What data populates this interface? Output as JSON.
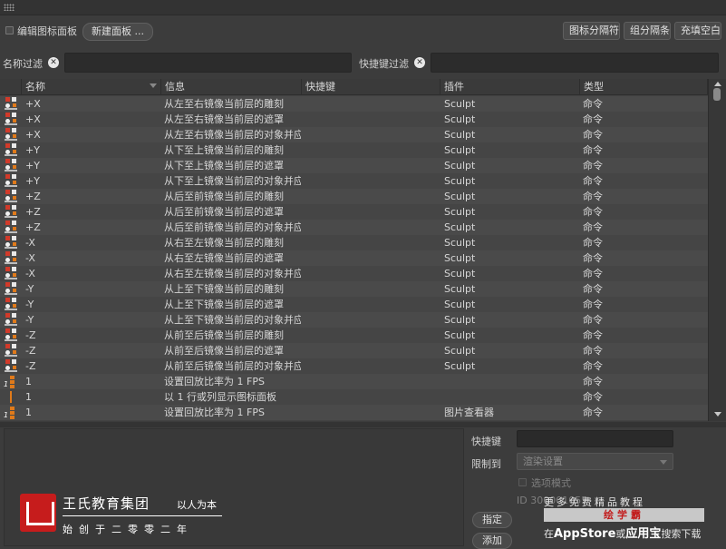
{
  "toolbar": {
    "edit_palette_label": "编辑图标面板",
    "new_palette_button": "新建面板 ...",
    "icon_separator_button": "图标分隔符",
    "group_separator_button": "组分隔条",
    "fill_space_button": "充填空白"
  },
  "filters": {
    "name_filter_label": "名称过滤",
    "name_filter_value": "",
    "shortcut_filter_label": "快捷键过滤",
    "shortcut_filter_value": ""
  },
  "table": {
    "columns": [
      "名称",
      "信息",
      "快捷键",
      "插件",
      "类型"
    ],
    "rows": [
      {
        "icon": "mirror-x-pos-icon",
        "name": "+X",
        "info": "从左至右镜像当前层的雕刻",
        "shortcut": "",
        "plugin": "Sculpt",
        "type": "命令"
      },
      {
        "icon": "mirror-x-pos-mask-icon",
        "name": "+X",
        "info": "从左至右镜像当前层的遮罩",
        "shortcut": "",
        "plugin": "Sculpt",
        "type": "命令"
      },
      {
        "icon": "mirror-x-pos-object-icon",
        "name": "+X",
        "info": "从左至右镜像当前层的对象并应",
        "shortcut": "",
        "plugin": "Sculpt",
        "type": "命令"
      },
      {
        "icon": "mirror-y-pos-icon",
        "name": "+Y",
        "info": "从下至上镜像当前层的雕刻",
        "shortcut": "",
        "plugin": "Sculpt",
        "type": "命令"
      },
      {
        "icon": "mirror-y-pos-mask-icon",
        "name": "+Y",
        "info": "从下至上镜像当前层的遮罩",
        "shortcut": "",
        "plugin": "Sculpt",
        "type": "命令"
      },
      {
        "icon": "mirror-y-pos-object-icon",
        "name": "+Y",
        "info": "从下至上镜像当前层的对象并应",
        "shortcut": "",
        "plugin": "Sculpt",
        "type": "命令"
      },
      {
        "icon": "mirror-z-pos-icon",
        "name": "+Z",
        "info": "从后至前镜像当前层的雕刻",
        "shortcut": "",
        "plugin": "Sculpt",
        "type": "命令"
      },
      {
        "icon": "mirror-z-pos-mask-icon",
        "name": "+Z",
        "info": "从后至前镜像当前层的遮罩",
        "shortcut": "",
        "plugin": "Sculpt",
        "type": "命令"
      },
      {
        "icon": "mirror-z-pos-object-icon",
        "name": "+Z",
        "info": "从后至前镜像当前层的对象并应",
        "shortcut": "",
        "plugin": "Sculpt",
        "type": "命令"
      },
      {
        "icon": "mirror-x-neg-icon",
        "name": "-X",
        "info": "从右至左镜像当前层的雕刻",
        "shortcut": "",
        "plugin": "Sculpt",
        "type": "命令"
      },
      {
        "icon": "mirror-x-neg-mask-icon",
        "name": "-X",
        "info": "从右至左镜像当前层的遮罩",
        "shortcut": "",
        "plugin": "Sculpt",
        "type": "命令"
      },
      {
        "icon": "mirror-x-neg-object-icon",
        "name": "-X",
        "info": "从右至左镜像当前层的对象并应",
        "shortcut": "",
        "plugin": "Sculpt",
        "type": "命令"
      },
      {
        "icon": "mirror-y-neg-icon",
        "name": "-Y",
        "info": "从上至下镜像当前层的雕刻",
        "shortcut": "",
        "plugin": "Sculpt",
        "type": "命令"
      },
      {
        "icon": "mirror-y-neg-mask-icon",
        "name": "-Y",
        "info": "从上至下镜像当前层的遮罩",
        "shortcut": "",
        "plugin": "Sculpt",
        "type": "命令"
      },
      {
        "icon": "mirror-y-neg-object-icon",
        "name": "-Y",
        "info": "从上至下镜像当前层的对象并应",
        "shortcut": "",
        "plugin": "Sculpt",
        "type": "命令"
      },
      {
        "icon": "mirror-z-neg-icon",
        "name": "-Z",
        "info": "从前至后镜像当前层的雕刻",
        "shortcut": "",
        "plugin": "Sculpt",
        "type": "命令"
      },
      {
        "icon": "mirror-z-neg-mask-icon",
        "name": "-Z",
        "info": "从前至后镜像当前层的遮罩",
        "shortcut": "",
        "plugin": "Sculpt",
        "type": "命令"
      },
      {
        "icon": "mirror-z-neg-object-icon",
        "name": "-Z",
        "info": "从前至后镜像当前层的对象并应",
        "shortcut": "",
        "plugin": "Sculpt",
        "type": "命令"
      },
      {
        "icon": "layout-one-column-icon",
        "name": "1",
        "info": "设置回放比率为 1 FPS",
        "shortcut": "",
        "plugin": "",
        "type": "命令"
      },
      {
        "icon": "layout-rows-icon",
        "name": "1",
        "info": "以 1 行或列显示图标面板",
        "shortcut": "",
        "plugin": "",
        "type": "命令"
      },
      {
        "icon": "layout-one-column-icon",
        "name": "1",
        "info": "设置回放比率为 1 FPS",
        "shortcut": "",
        "plugin": "图片查看器",
        "type": "命令"
      }
    ]
  },
  "properties": {
    "shortcut_label": "快捷键",
    "shortcut_value": "",
    "restrict_label": "限制到",
    "restrict_value": "渲染设置",
    "option_mode_label": "选项模式",
    "id_text": "ID 300001055",
    "assign_button": "指定",
    "add_button": "添加"
  },
  "watermark": {
    "brand_title": "王氏教育集团",
    "brand_slogan": "以人为本",
    "brand_sub": "始创于二零零二年",
    "promo_top": "更多免费精品教程",
    "promo_bar": "绘学霸",
    "promo_bottom_prefix": "在",
    "promo_bottom_appstore": "AppStore",
    "promo_bottom_mid": "或",
    "promo_bottom_app": "应用宝",
    "promo_bottom_suffix": "搜索下载"
  },
  "colors": {
    "background": "#3c3c3c",
    "accent_red": "#c61c1c",
    "icon_orange": "#e07a1a",
    "icon_red": "#d23a2a"
  }
}
